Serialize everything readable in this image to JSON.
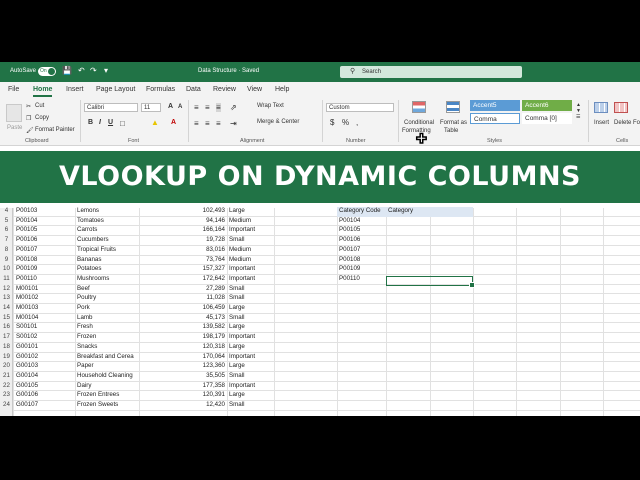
{
  "titlebar": {
    "autosave_label": "AutoSave",
    "autosave_state": "On",
    "document_title": "Data Structure  ·  Saved",
    "search_placeholder": "Search"
  },
  "tabs": [
    "File",
    "Home",
    "Insert",
    "Page Layout",
    "Formulas",
    "Data",
    "Review",
    "View",
    "Help"
  ],
  "active_tab": "Home",
  "ribbon": {
    "clipboard": {
      "paste": "Paste",
      "cut": "Cut",
      "copy": "Copy",
      "format_painter": "Format Painter",
      "label": "Clipboard"
    },
    "font": {
      "name": "Calibri",
      "size": "11",
      "label": "Font"
    },
    "alignment": {
      "wrap_text": "Wrap Text",
      "merge_center": "Merge & Center",
      "label": "Alignment"
    },
    "number": {
      "format": "Custom",
      "label": "Number"
    },
    "styles": {
      "conditional": "Conditional",
      "formatting": "Formatting",
      "format_as": "Format as",
      "table": "Table",
      "accent5": "Accent5",
      "accent6": "Accent6",
      "comma": "Comma",
      "comma0": "Comma [0]",
      "label": "Styles"
    },
    "cells": {
      "insert": "Insert",
      "delete": "Delete",
      "format": "Fo",
      "label": "Cells"
    }
  },
  "colors": {
    "excel_green": "#217346",
    "accent5": "#5b9bd5",
    "accent6": "#70ad47"
  },
  "banner": {
    "title": "VLOOKUP ON DYNAMIC COLUMNS"
  },
  "sheet": {
    "rows": [
      {
        "num": "4",
        "code": "P00103",
        "name": "Lemons",
        "value": "102,493",
        "size": "Large"
      },
      {
        "num": "5",
        "code": "P00104",
        "name": "Tomatoes",
        "value": "94,146",
        "size": "Medium"
      },
      {
        "num": "6",
        "code": "P00105",
        "name": "Carrots",
        "value": "166,164",
        "size": "Important"
      },
      {
        "num": "7",
        "code": "P00106",
        "name": "Cucumbers",
        "value": "19,728",
        "size": "Small"
      },
      {
        "num": "8",
        "code": "P00107",
        "name": "Tropical Fruits",
        "value": "83,016",
        "size": "Medium"
      },
      {
        "num": "9",
        "code": "P00108",
        "name": "Bananas",
        "value": "73,764",
        "size": "Medium"
      },
      {
        "num": "10",
        "code": "P00109",
        "name": "Potatoes",
        "value": "157,327",
        "size": "Important"
      },
      {
        "num": "11",
        "code": "P00110",
        "name": "Mushrooms",
        "value": "172,642",
        "size": "Important"
      },
      {
        "num": "12",
        "code": "M00101",
        "name": "Beef",
        "value": "27,289",
        "size": "Small"
      },
      {
        "num": "13",
        "code": "M00102",
        "name": "Poultry",
        "value": "11,028",
        "size": "Small"
      },
      {
        "num": "14",
        "code": "M00103",
        "name": "Pork",
        "value": "106,459",
        "size": "Large"
      },
      {
        "num": "15",
        "code": "M00104",
        "name": "Lamb",
        "value": "45,173",
        "size": "Small"
      },
      {
        "num": "16",
        "code": "S00101",
        "name": "Fresh",
        "value": "139,582",
        "size": "Large"
      },
      {
        "num": "17",
        "code": "S00102",
        "name": "Frozen",
        "value": "198,179",
        "size": "Important"
      },
      {
        "num": "18",
        "code": "G00101",
        "name": "Snacks",
        "value": "120,318",
        "size": "Large"
      },
      {
        "num": "19",
        "code": "G00102",
        "name": "Breakfast and Cerea",
        "value": "170,064",
        "size": "Important"
      },
      {
        "num": "20",
        "code": "G00103",
        "name": "Paper",
        "value": "123,360",
        "size": "Large"
      },
      {
        "num": "21",
        "code": "G00104",
        "name": "Household Cleaning",
        "value": "35,505",
        "size": "Small"
      },
      {
        "num": "22",
        "code": "G00105",
        "name": "Dairy",
        "value": "177,358",
        "size": "Important"
      },
      {
        "num": "23",
        "code": "G00106",
        "name": "Frozen Entrees",
        "value": "120,391",
        "size": "Large"
      },
      {
        "num": "24",
        "code": "G00107",
        "name": "Frozen Sweets",
        "value": "12,420",
        "size": "Small"
      }
    ],
    "lookup_header": {
      "code": "Category Code",
      "category": "Category"
    },
    "lookup_codes": [
      "P00104",
      "P00105",
      "P00106",
      "P00107",
      "P00108",
      "P00109",
      "P00110"
    ]
  }
}
